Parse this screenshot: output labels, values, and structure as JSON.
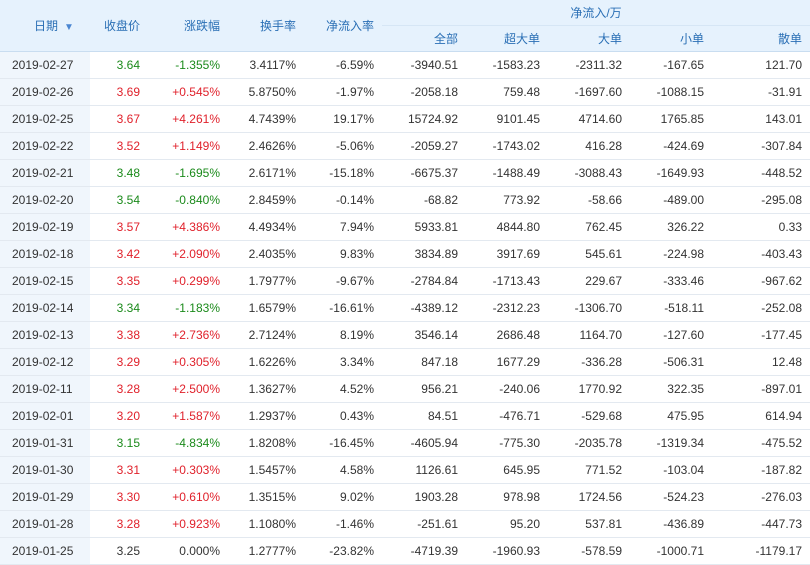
{
  "headers": {
    "date": "日期",
    "close": "收盘价",
    "change": "涨跌幅",
    "turnover": "换手率",
    "net_rate": "净流入率",
    "net_group": "净流入/万",
    "all": "全部",
    "super_large": "超大单",
    "large": "大单",
    "small": "小单",
    "retail": "散单"
  },
  "sort_icon": "arrow-down-icon",
  "colors": {
    "up": "#e0212b",
    "down": "#1b8a1b",
    "header_bg": "#e6f2fd",
    "header_text": "#2a6fb5"
  },
  "rows": [
    {
      "date": "2019-02-27",
      "close": "3.64",
      "change": "-1.355%",
      "turnover": "3.4117%",
      "net_rate": "-6.59%",
      "all": "-3940.51",
      "super_large": "-1583.23",
      "large": "-2311.32",
      "small": "-167.65",
      "retail": "121.70",
      "dir": "down"
    },
    {
      "date": "2019-02-26",
      "close": "3.69",
      "change": "+0.545%",
      "turnover": "5.8750%",
      "net_rate": "-1.97%",
      "all": "-2058.18",
      "super_large": "759.48",
      "large": "-1697.60",
      "small": "-1088.15",
      "retail": "-31.91",
      "dir": "up"
    },
    {
      "date": "2019-02-25",
      "close": "3.67",
      "change": "+4.261%",
      "turnover": "4.7439%",
      "net_rate": "19.17%",
      "all": "15724.92",
      "super_large": "9101.45",
      "large": "4714.60",
      "small": "1765.85",
      "retail": "143.01",
      "dir": "up"
    },
    {
      "date": "2019-02-22",
      "close": "3.52",
      "change": "+1.149%",
      "turnover": "2.4626%",
      "net_rate": "-5.06%",
      "all": "-2059.27",
      "super_large": "-1743.02",
      "large": "416.28",
      "small": "-424.69",
      "retail": "-307.84",
      "dir": "up"
    },
    {
      "date": "2019-02-21",
      "close": "3.48",
      "change": "-1.695%",
      "turnover": "2.6171%",
      "net_rate": "-15.18%",
      "all": "-6675.37",
      "super_large": "-1488.49",
      "large": "-3088.43",
      "small": "-1649.93",
      "retail": "-448.52",
      "dir": "down"
    },
    {
      "date": "2019-02-20",
      "close": "3.54",
      "change": "-0.840%",
      "turnover": "2.8459%",
      "net_rate": "-0.14%",
      "all": "-68.82",
      "super_large": "773.92",
      "large": "-58.66",
      "small": "-489.00",
      "retail": "-295.08",
      "dir": "down"
    },
    {
      "date": "2019-02-19",
      "close": "3.57",
      "change": "+4.386%",
      "turnover": "4.4934%",
      "net_rate": "7.94%",
      "all": "5933.81",
      "super_large": "4844.80",
      "large": "762.45",
      "small": "326.22",
      "retail": "0.33",
      "dir": "up"
    },
    {
      "date": "2019-02-18",
      "close": "3.42",
      "change": "+2.090%",
      "turnover": "2.4035%",
      "net_rate": "9.83%",
      "all": "3834.89",
      "super_large": "3917.69",
      "large": "545.61",
      "small": "-224.98",
      "retail": "-403.43",
      "dir": "up"
    },
    {
      "date": "2019-02-15",
      "close": "3.35",
      "change": "+0.299%",
      "turnover": "1.7977%",
      "net_rate": "-9.67%",
      "all": "-2784.84",
      "super_large": "-1713.43",
      "large": "229.67",
      "small": "-333.46",
      "retail": "-967.62",
      "dir": "up"
    },
    {
      "date": "2019-02-14",
      "close": "3.34",
      "change": "-1.183%",
      "turnover": "1.6579%",
      "net_rate": "-16.61%",
      "all": "-4389.12",
      "super_large": "-2312.23",
      "large": "-1306.70",
      "small": "-518.11",
      "retail": "-252.08",
      "dir": "down"
    },
    {
      "date": "2019-02-13",
      "close": "3.38",
      "change": "+2.736%",
      "turnover": "2.7124%",
      "net_rate": "8.19%",
      "all": "3546.14",
      "super_large": "2686.48",
      "large": "1164.70",
      "small": "-127.60",
      "retail": "-177.45",
      "dir": "up"
    },
    {
      "date": "2019-02-12",
      "close": "3.29",
      "change": "+0.305%",
      "turnover": "1.6226%",
      "net_rate": "3.34%",
      "all": "847.18",
      "super_large": "1677.29",
      "large": "-336.28",
      "small": "-506.31",
      "retail": "12.48",
      "dir": "up"
    },
    {
      "date": "2019-02-11",
      "close": "3.28",
      "change": "+2.500%",
      "turnover": "1.3627%",
      "net_rate": "4.52%",
      "all": "956.21",
      "super_large": "-240.06",
      "large": "1770.92",
      "small": "322.35",
      "retail": "-897.01",
      "dir": "up"
    },
    {
      "date": "2019-02-01",
      "close": "3.20",
      "change": "+1.587%",
      "turnover": "1.2937%",
      "net_rate": "0.43%",
      "all": "84.51",
      "super_large": "-476.71",
      "large": "-529.68",
      "small": "475.95",
      "retail": "614.94",
      "dir": "up"
    },
    {
      "date": "2019-01-31",
      "close": "3.15",
      "change": "-4.834%",
      "turnover": "1.8208%",
      "net_rate": "-16.45%",
      "all": "-4605.94",
      "super_large": "-775.30",
      "large": "-2035.78",
      "small": "-1319.34",
      "retail": "-475.52",
      "dir": "down"
    },
    {
      "date": "2019-01-30",
      "close": "3.31",
      "change": "+0.303%",
      "turnover": "1.5457%",
      "net_rate": "4.58%",
      "all": "1126.61",
      "super_large": "645.95",
      "large": "771.52",
      "small": "-103.04",
      "retail": "-187.82",
      "dir": "up"
    },
    {
      "date": "2019-01-29",
      "close": "3.30",
      "change": "+0.610%",
      "turnover": "1.3515%",
      "net_rate": "9.02%",
      "all": "1903.28",
      "super_large": "978.98",
      "large": "1724.56",
      "small": "-524.23",
      "retail": "-276.03",
      "dir": "up"
    },
    {
      "date": "2019-01-28",
      "close": "3.28",
      "change": "+0.923%",
      "turnover": "1.1080%",
      "net_rate": "-1.46%",
      "all": "-251.61",
      "super_large": "95.20",
      "large": "537.81",
      "small": "-436.89",
      "retail": "-447.73",
      "dir": "up"
    },
    {
      "date": "2019-01-25",
      "close": "3.25",
      "change": "0.000%",
      "turnover": "1.2777%",
      "net_rate": "-23.82%",
      "all": "-4719.39",
      "super_large": "-1960.93",
      "large": "-578.59",
      "small": "-1000.71",
      "retail": "-1179.17",
      "dir": "flat"
    }
  ]
}
